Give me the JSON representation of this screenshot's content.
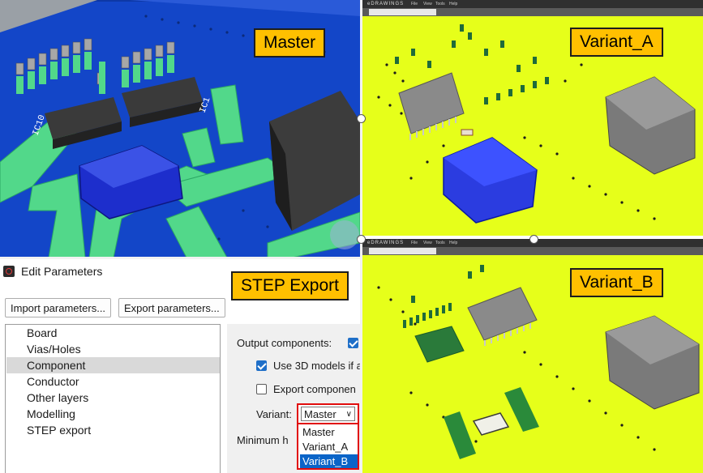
{
  "labels": {
    "master": "Master",
    "variant_a": "Variant_A",
    "variant_b": "Variant_B",
    "step_export": "STEP Export"
  },
  "master_view": {
    "component_labels": [
      "IC10",
      "IC1"
    ]
  },
  "edrawings": {
    "logo": "eDRAWINGS",
    "menu": [
      "File",
      "View",
      "Tools",
      "Help"
    ]
  },
  "dialog": {
    "title": "Edit Parameters",
    "import_button": "Import parameters...",
    "export_button": "Export parameters...",
    "tree_items": [
      "Board",
      "Vias/Holes",
      "Component",
      "Conductor",
      "Other layers",
      "Modelling",
      "STEP export"
    ],
    "selected_tree_item": "Component",
    "output_components_label": "Output components:",
    "use_3d_models_label": "Use 3D models if a",
    "export_components_label": "Export componen",
    "variant_label": "Variant:",
    "variant_value": "Master",
    "variant_options": [
      "Master",
      "Variant_A",
      "Variant_B"
    ],
    "highlighted_option": "Variant_B",
    "minimum_label": "Minimum h",
    "output_components_checked": true,
    "use_3d_models_checked": true,
    "export_components_checked": false
  },
  "colors": {
    "board_blue": "#1346c8",
    "copper_green": "#52d88a",
    "board_yellow": "#e6ff1a",
    "callout_orange": "#ffc000",
    "highlight_red": "#e10c0c",
    "selection_blue": "#0a64c8"
  }
}
